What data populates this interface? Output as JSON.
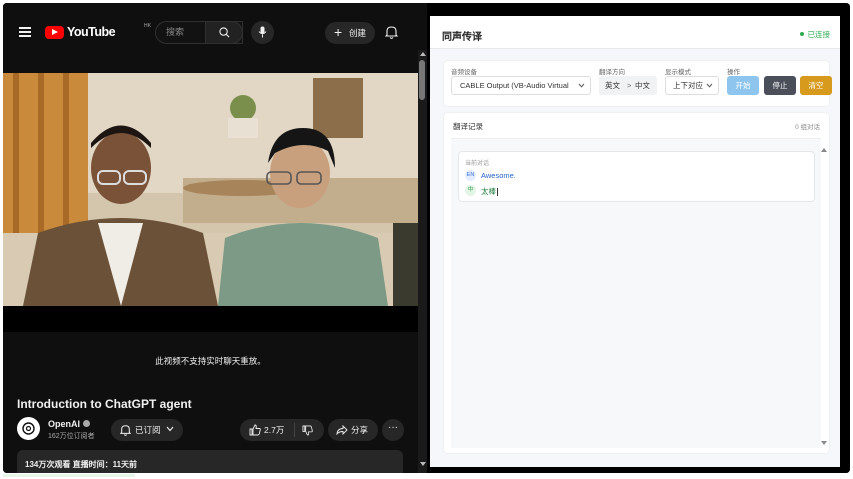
{
  "youtube": {
    "logo_text": "YouTube",
    "region": "HK",
    "search_placeholder": "搜索",
    "create_label": "创建",
    "chat_unavailable": "此视频不支持实时聊天重放。",
    "video_title": "Introduction to ChatGPT agent",
    "channel_name": "OpenAI",
    "subscribers": "162万位订阅者",
    "subscribed_label": "已订阅",
    "likes": "2.7万",
    "share_label": "分享",
    "more_label": "···",
    "description_meta": "134万次观看  直播时间：11天前",
    "icons": [
      "menu-icon",
      "search-icon",
      "mic-icon",
      "plus-icon",
      "bell-icon",
      "thumbs-up-icon",
      "thumbs-down-icon",
      "share-icon",
      "chevron-down-icon",
      "openai-logo-icon"
    ]
  },
  "translator": {
    "title": "同声传译",
    "status": "已连接",
    "controls": {
      "device_label": "音频设备",
      "device_value": "CABLE Output (VB-Audio Virtual",
      "direction_label": "翻译方向",
      "direction_from": "英文",
      "direction_arrow": ">",
      "direction_to": "中文",
      "mode_label": "显示模式",
      "mode_value": "上下对应",
      "actions_label": "操作",
      "start_label": "开始",
      "stop_label": "停止",
      "clear_label": "清空"
    },
    "records": {
      "title": "翻译记录",
      "count": "0 组对话",
      "current_label": "当前对话",
      "source_tag": "EN",
      "source_text": "Awesome.",
      "target_tag": "中",
      "target_text": "太棒"
    },
    "colors": {
      "status": "#2eaa4f",
      "start": "#8ec5ee",
      "stop": "#4a4f5a",
      "clear": "#d89a1c"
    }
  }
}
